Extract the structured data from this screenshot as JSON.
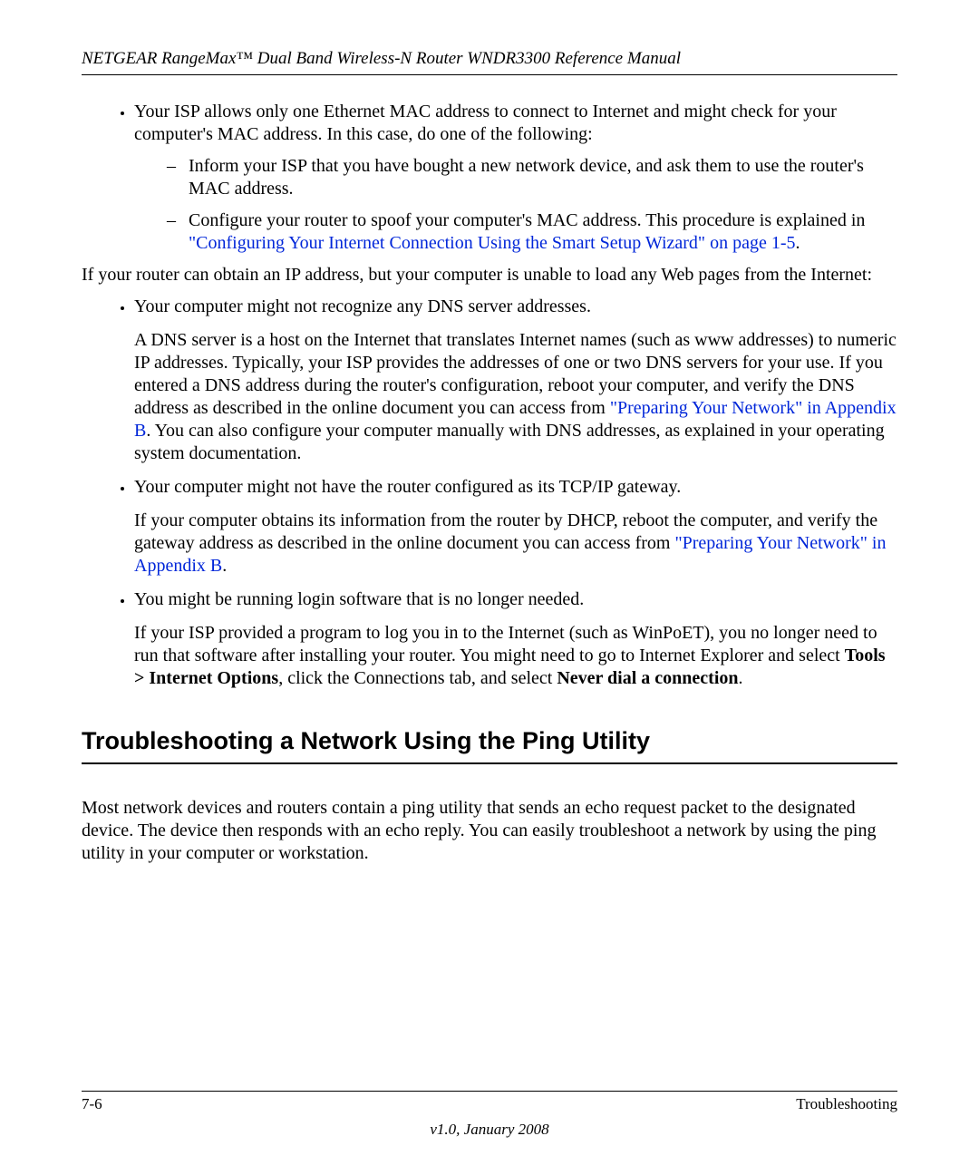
{
  "header": {
    "running": "NETGEAR RangeMax™ Dual Band Wireless-N Router WNDR3300 Reference Manual"
  },
  "content": {
    "bullet1": "Your ISP allows only one Ethernet MAC address to connect to Internet and might check for your computer's MAC address. In this case, do one of the following:",
    "dash1": "Inform your ISP that you have bought a new network device, and ask them to use the router's MAC address.",
    "dash2_a": "Configure your router to spoof your computer's MAC address. This procedure is explained in ",
    "dash2_link": "\"Configuring Your Internet Connection Using the Smart Setup Wizard\" on page 1-5",
    "dash2_b": ".",
    "para1": "If your router can obtain an IP address, but your computer is unable to load any Web pages from the Internet:",
    "bullet2": "Your computer might not recognize any DNS server addresses.",
    "bullet2_para_a": "A DNS server is a host on the Internet that translates Internet names (such as www addresses) to numeric IP addresses. Typically, your ISP provides the addresses of one or two DNS servers for your use. If you entered a DNS address during the router's configuration, reboot your computer, and verify the DNS address as described in the online document you can access from ",
    "bullet2_link": "\"Preparing Your Network\" in Appendix B",
    "bullet2_para_b": ". You can also configure your computer manually with DNS addresses, as explained in your operating system documentation.",
    "bullet3": "Your computer might not have the router configured as its TCP/IP gateway.",
    "bullet3_para_a": "If your computer obtains its information from the router by DHCP, reboot the computer, and verify the gateway address as described in the online document you can access from ",
    "bullet3_link": "\"Preparing Your Network\" in Appendix B",
    "bullet3_para_b": ".",
    "bullet4": "You might be running login software that is no longer needed.",
    "bullet4_para_a": "If your ISP provided a program to log you in to the Internet (such as WinPoET), you no longer need to run that software after installing your router. You might need to go to Internet Explorer and select ",
    "bullet4_bold1": "Tools > Internet Options",
    "bullet4_para_b": ", click the Connections tab, and select ",
    "bullet4_bold2": "Never dial a connection",
    "bullet4_para_c": ".",
    "heading": "Troubleshooting a Network Using the Ping Utility",
    "section_para": "Most network devices and routers contain a ping utility that sends an echo request packet to the designated device. The device then responds with an echo reply. You can easily troubleshoot a network by using the ping utility in your computer or workstation."
  },
  "footer": {
    "page_num": "7-6",
    "section": "Troubleshooting",
    "version": "v1.0, January 2008"
  }
}
